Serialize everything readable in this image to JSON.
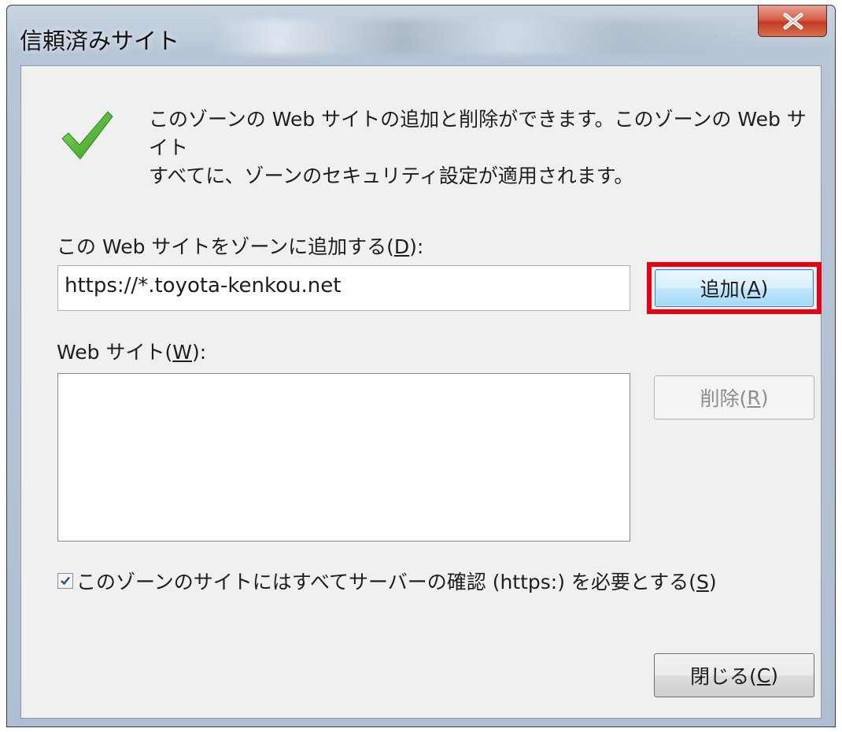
{
  "window": {
    "title": "信頼済みサイト"
  },
  "info": {
    "line1": "このゾーンの Web サイトの追加と削除ができます。このゾーンの Web サイト",
    "line2": "すべてに、ゾーンのセキュリティ設定が適用されます。"
  },
  "add_site": {
    "label_prefix": "この Web サイトをゾーンに追加する(",
    "label_key": "D",
    "label_suffix": "):",
    "input_value": "https://*.toyota-kenkou.net",
    "button_prefix": "追加(",
    "button_key": "A",
    "button_suffix": ")"
  },
  "sites": {
    "label_prefix": "Web サイト(",
    "label_key": "W",
    "label_suffix": "):",
    "items": [],
    "remove_prefix": "削除(",
    "remove_key": "R",
    "remove_suffix": ")"
  },
  "require_https": {
    "checked": true,
    "label_prefix": "このゾーンのサイトにはすべてサーバーの確認 (https:) を必要とする(",
    "label_key": "S",
    "label_suffix": ")"
  },
  "footer": {
    "close_prefix": "閉じる(",
    "close_key": "C",
    "close_suffix": ")"
  },
  "colors": {
    "highlight": "#e60012",
    "check_icon": "#4caf2a",
    "dialog_bg": "#f0f0f0"
  },
  "icons": {
    "info": "green-checkmark-icon",
    "close": "close-x-icon"
  }
}
